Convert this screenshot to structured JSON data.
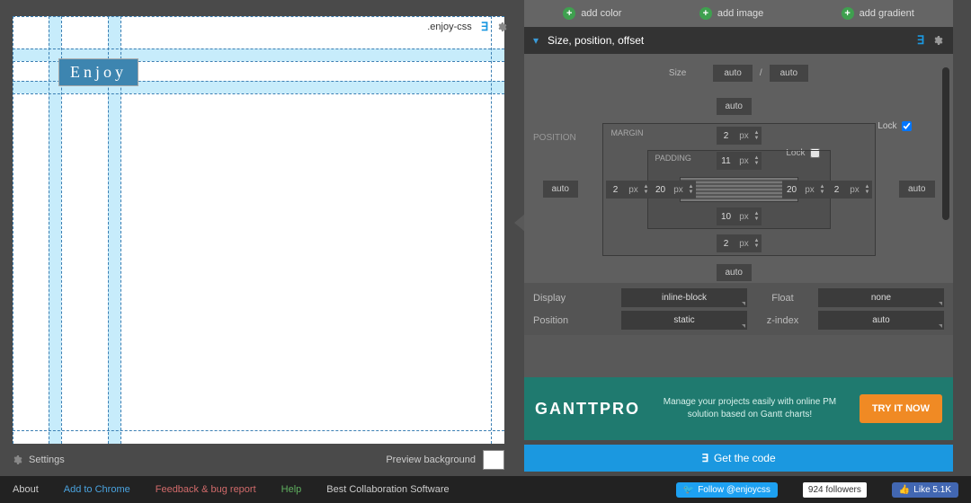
{
  "selector": ".enjoy-css",
  "preview_text": "Enjoy",
  "preview_footer": {
    "settings": "Settings",
    "bg_label": "Preview background"
  },
  "add_row": {
    "color": "add color",
    "image": "add image",
    "gradient": "add gradient"
  },
  "accordion": {
    "title": "Size, position, offset"
  },
  "size": {
    "label": "Size",
    "w": "auto",
    "sep": "/",
    "h": "auto"
  },
  "position_label": "POSITION",
  "box": {
    "margin_label": "MARGIN",
    "padding_label": "PADDING",
    "lock_margin": "Lock",
    "lock_padding": "Lock",
    "pos_top": "auto",
    "pos_left": "auto",
    "pos_right": "auto",
    "pos_bottom": "auto",
    "mt": {
      "v": "2",
      "u": "px"
    },
    "mr": {
      "v": "2",
      "u": "px"
    },
    "mb": {
      "v": "2",
      "u": "px"
    },
    "ml": {
      "v": "2",
      "u": "px"
    },
    "pt": {
      "v": "11",
      "u": "px"
    },
    "pr": {
      "v": "20",
      "u": "px"
    },
    "pb": {
      "v": "10",
      "u": "px"
    },
    "pl": {
      "v": "20",
      "u": "px"
    }
  },
  "grid": {
    "display_l": "Display",
    "display_v": "inline-block",
    "float_l": "Float",
    "float_v": "none",
    "position_l": "Position",
    "position_v": "static",
    "zindex_l": "z-index",
    "zindex_v": "auto"
  },
  "promo": {
    "logo": "GANTTPRO",
    "text": "Manage your projects easily with online PM solution based on Gantt charts!",
    "btn": "TRY IT NOW"
  },
  "getcode": "Get the code",
  "footer": {
    "about": "About",
    "chrome": "Add to Chrome",
    "feedback": "Feedback & bug report",
    "help": "Help",
    "best": "Best Collaboration Software",
    "tw": "Follow @enjoycss",
    "tw_count": "924 followers",
    "fb": "Like 5.1K"
  }
}
